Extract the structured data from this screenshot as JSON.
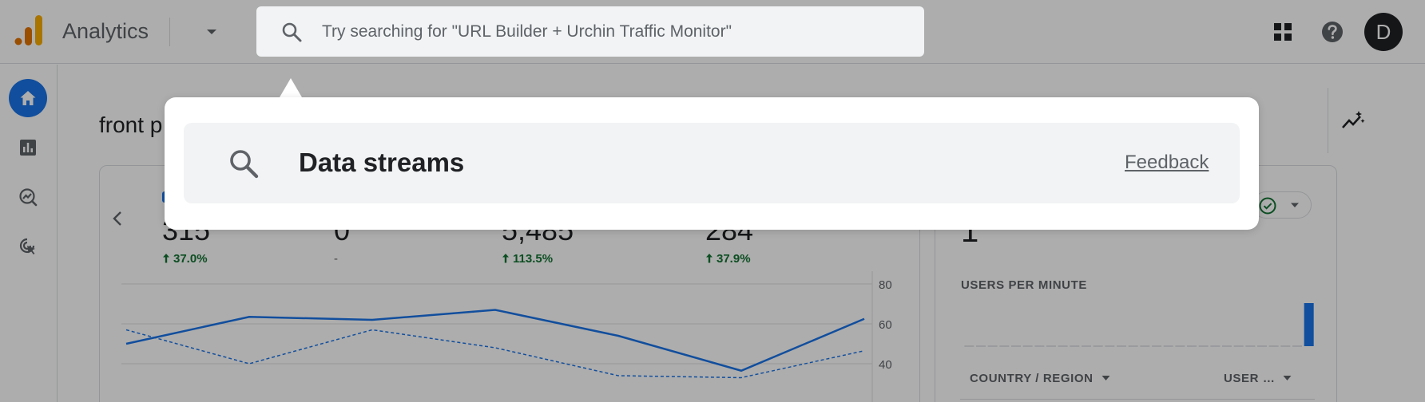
{
  "header": {
    "app_name": "Analytics",
    "search_placeholder": "Try searching for \"URL Builder + Urchin Traffic Monitor\"",
    "avatar_initial": "D",
    "logo_colors": [
      "#f9ab00",
      "#e37400",
      "#e37400"
    ]
  },
  "sidebar": {
    "items": [
      {
        "name": "home",
        "icon": "home-icon",
        "active": true
      },
      {
        "name": "reports",
        "icon": "bar-chart-icon",
        "active": false
      },
      {
        "name": "explore",
        "icon": "explore-icon",
        "active": false
      },
      {
        "name": "advertising",
        "icon": "advertising-icon",
        "active": false
      }
    ]
  },
  "page": {
    "title_visible": "front p"
  },
  "overview_card": {
    "metrics": [
      {
        "value": "315",
        "change": "37.0%",
        "direction": "up"
      },
      {
        "value": "0",
        "change": "-",
        "direction": "none"
      },
      {
        "value": "5,485",
        "change": "113.5%",
        "direction": "up"
      },
      {
        "value": "284",
        "change": "37.9%",
        "direction": "up"
      }
    ]
  },
  "chart_data": {
    "type": "line",
    "x": [
      0,
      1,
      2,
      3,
      4,
      5,
      6
    ],
    "series": [
      {
        "style": "solid",
        "color": "#1a73e8",
        "values": [
          50,
          63.5,
          62,
          67,
          54,
          36.5,
          62.5
        ]
      },
      {
        "style": "dashed",
        "color": "#1a73e8",
        "values": [
          57,
          40,
          57,
          48,
          34,
          33,
          46.5
        ]
      }
    ],
    "ylim": [
      20,
      80
    ],
    "yticks": [
      "80",
      "60",
      "40"
    ],
    "grid": true,
    "axis_position": "right"
  },
  "realtime_card": {
    "value": "1",
    "users_per_minute_label": "USERS PER MINUTE",
    "bars": [
      0,
      0,
      0,
      0,
      0,
      0,
      0,
      0,
      0,
      0,
      0,
      0,
      0,
      0,
      0,
      0,
      0,
      0,
      0,
      0,
      0,
      0,
      0,
      0,
      0,
      0,
      0,
      0,
      0,
      1
    ],
    "columns": [
      "COUNTRY / REGION",
      "USER …"
    ],
    "status_icon": "check-circle-icon"
  },
  "search_popup": {
    "suggestion": "Data streams",
    "feedback_label": "Feedback"
  },
  "colors": {
    "accent": "#1a73e8",
    "positive": "#137333",
    "overlay": "rgba(0,0,0,0.32)"
  }
}
